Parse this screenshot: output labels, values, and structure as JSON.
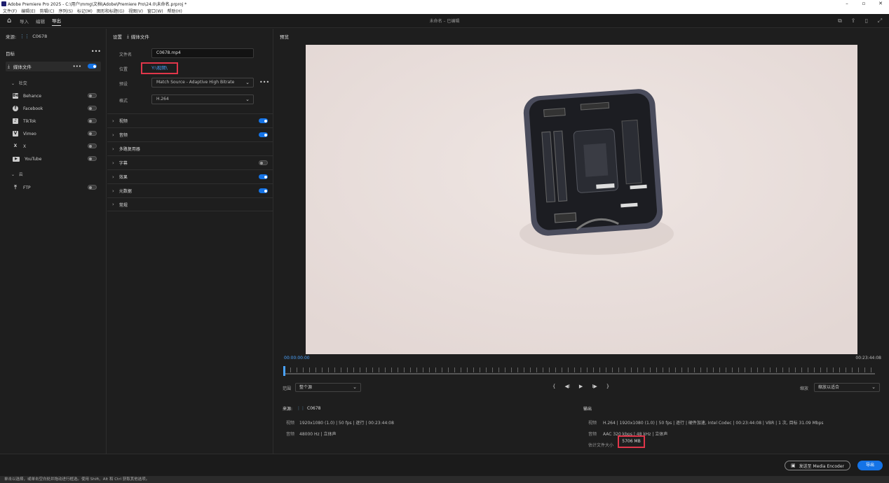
{
  "titlebar": {
    "title": "Adobe Premiere Pro 2025 - C:\\用户\\mmg\\文档\\Adobe\\Premiere Pro\\24.0\\未命名.prproj *",
    "minimize": "–",
    "maximize": "▫",
    "close": "✕"
  },
  "menubar": [
    "文件(F)",
    "编辑(E)",
    "剪辑(C)",
    "序列(S)",
    "标记(M)",
    "图形和标题(G)",
    "视图(V)",
    "窗口(W)",
    "帮助(H)"
  ],
  "topnav": {
    "tabs": [
      "导入",
      "编辑",
      "导出"
    ],
    "active_tab": 2,
    "project_name": "未命名 – 已编辑"
  },
  "source": {
    "label": "来源:",
    "clip": "C0678"
  },
  "destinations": {
    "header": "目标",
    "media_file": {
      "label": "媒体文件",
      "enabled": true
    },
    "social_group": "社交",
    "services": [
      {
        "name": "Behance",
        "icon": "Be",
        "icon_name": "behance-icon",
        "enabled": false
      },
      {
        "name": "Facebook",
        "icon": "f",
        "icon_name": "facebook-icon",
        "enabled": false
      },
      {
        "name": "TikTok",
        "icon": "♪",
        "icon_name": "tiktok-icon",
        "enabled": false
      },
      {
        "name": "Vimeo",
        "icon": "V",
        "icon_name": "vimeo-icon",
        "enabled": false
      },
      {
        "name": "X",
        "icon": "X",
        "icon_name": "x-icon",
        "enabled": false
      },
      {
        "name": "YouTube",
        "icon": "▶",
        "icon_name": "youtube-icon",
        "enabled": false
      }
    ],
    "cloud_group": "云",
    "ftp": {
      "name": "FTP",
      "enabled": false
    }
  },
  "settings": {
    "header": "设置",
    "target": "媒体文件",
    "filename_label": "文件名",
    "filename": "C0678.mp4",
    "location_label": "位置",
    "location": "Y:\\视频\\",
    "preset_label": "预设",
    "preset": "Match Source - Adaptive High Bitrate",
    "format_label": "格式",
    "format": "H.264",
    "sections": [
      {
        "label": "视频",
        "toggle": true,
        "on": true
      },
      {
        "label": "音频",
        "toggle": true,
        "on": true
      },
      {
        "label": "多路复用器",
        "toggle": false,
        "on": false
      },
      {
        "label": "字幕",
        "toggle": true,
        "on": false
      },
      {
        "label": "效果",
        "toggle": true,
        "on": true
      },
      {
        "label": "元数据",
        "toggle": true,
        "on": true
      },
      {
        "label": "常规",
        "toggle": false,
        "on": false
      }
    ]
  },
  "preview": {
    "label": "预览",
    "timecode_start": "00:00:00:00",
    "timecode_end": "00:23:44:08",
    "range_label": "范围",
    "range_value": "整个源",
    "scale_label": "缩放",
    "scale_value": "缩放以适合",
    "transport": [
      "{",
      "◀I",
      "▶",
      "I▶",
      "}"
    ]
  },
  "source_info": {
    "label": "来源:",
    "clip": "C0678",
    "video_label": "视频",
    "video": "1920x1080 (1.0) | 50 fps | 逐行 | 00:23:44:08",
    "audio_label": "音频",
    "audio": "48000 Hz | 立体声"
  },
  "output_info": {
    "label": "输出",
    "video_label": "视频",
    "video": "H.264 | 1920x1080 (1.0) | 50 fps | 逐行 | 硬件加速, Intel Codec | 00:23:44:08 | VBR | 1 次, 目标 31.09 Mbps",
    "audio_label": "音频",
    "audio": "AAC 320 kbps | 48 kHz | 立体声",
    "size_label": "估计文件大小",
    "size": "5706 MB"
  },
  "buttons": {
    "media_encoder": "发送至 Media Encoder",
    "export": "导出"
  },
  "status": "单击以选择，或单击空白处并拖动进行框选。使用 Shift、Alt 和 Ctrl 获取其他选项。"
}
